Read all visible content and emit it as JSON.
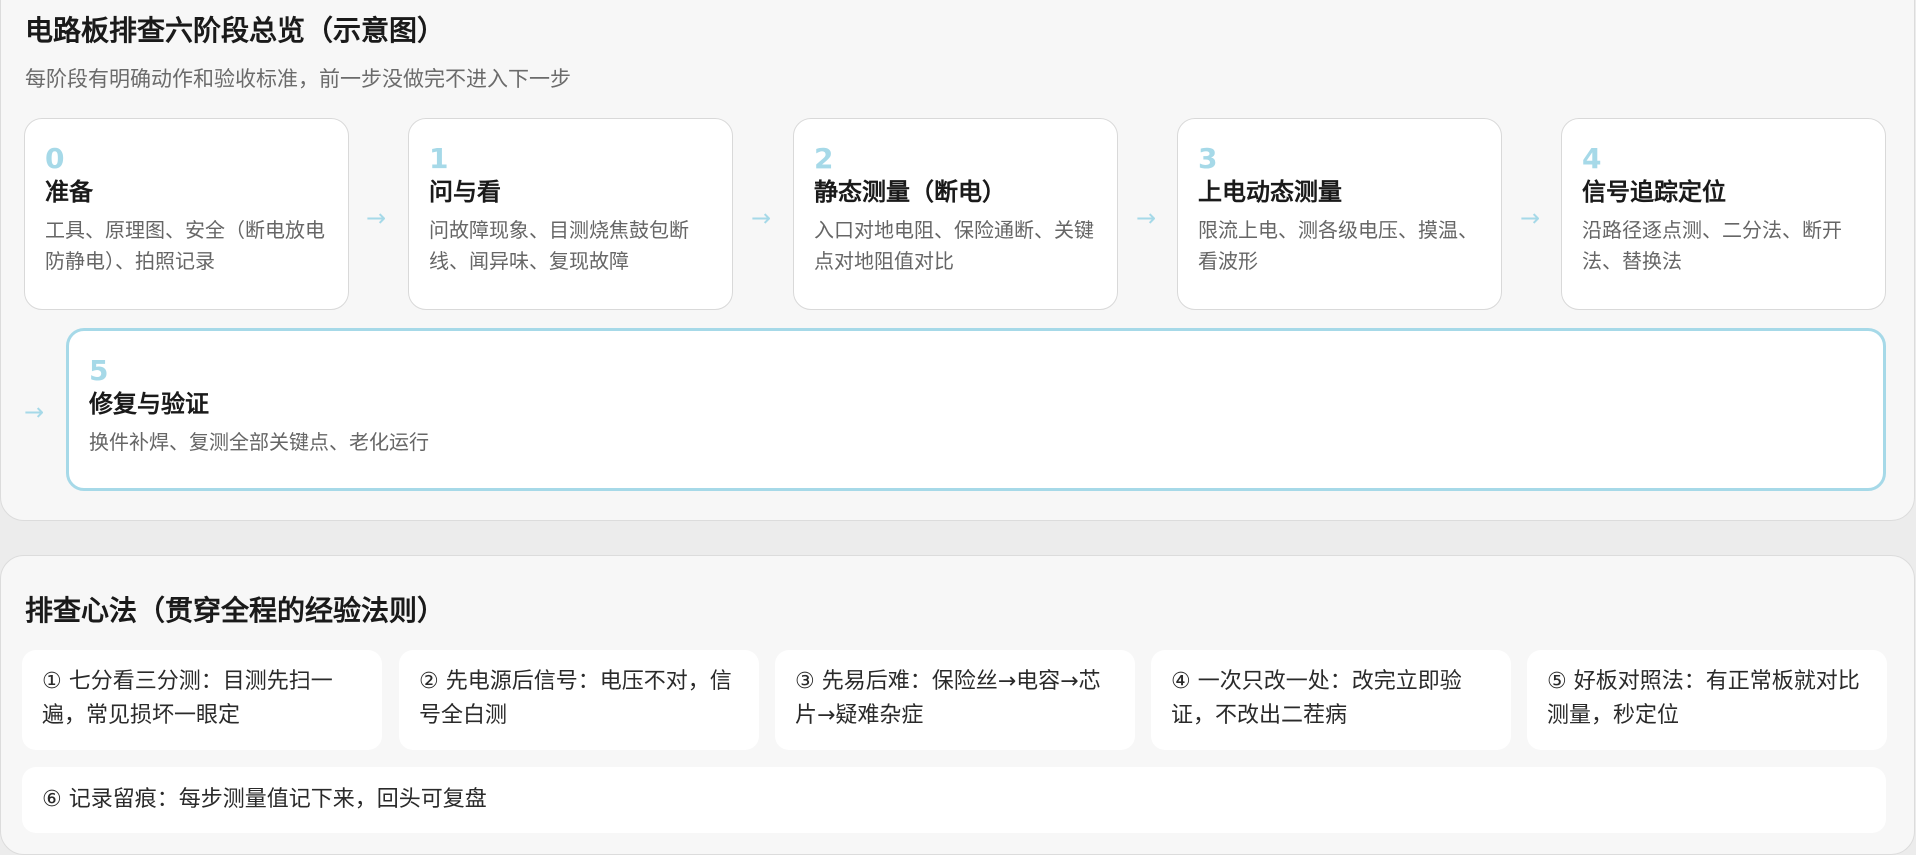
{
  "stages_panel": {
    "title": "电路板排查六阶段总览（示意图）",
    "subtitle": "每阶段有明确动作和验收标准，前一步没做完不进入下一步",
    "arrow_glyph": "→",
    "stages": [
      {
        "num": "0",
        "title": "准备",
        "desc": "工具、原理图、安全（断电放电防静电）、拍照记录"
      },
      {
        "num": "1",
        "title": "问与看",
        "desc": "问故障现象、目测烧焦鼓包断线、闻异味、复现故障"
      },
      {
        "num": "2",
        "title": "静态测量（断电）",
        "desc": "入口对地电阻、保险通断、关键点对地阻值对比"
      },
      {
        "num": "3",
        "title": "上电动态测量",
        "desc": "限流上电、测各级电压、摸温、看波形"
      },
      {
        "num": "4",
        "title": "信号追踪定位",
        "desc": "沿路径逐点测、二分法、断开法、替换法"
      },
      {
        "num": "5",
        "title": "修复与验证",
        "desc": "换件补焊、复测全部关键点、老化运行"
      }
    ]
  },
  "rules_panel": {
    "title": "排查心法（贯穿全程的经验法则）",
    "rules": [
      "① 七分看三分测：目测先扫一遍，常见损坏一眼定",
      "② 先电源后信号：电压不对，信号全白测",
      "③ 先易后难：保险丝→电容→芯片→疑难杂症",
      "④ 一次只改一处：改完立即验证，不改出二茬病",
      "⑤ 好板对照法：有正常板就对比测量，秒定位",
      "⑥ 记录留痕：每步测量值记下来，回头可复盘"
    ]
  },
  "colors": {
    "accent": "#a6d9e8",
    "card_bg": "#ffffff",
    "panel_bg": "#f7f7f7"
  }
}
